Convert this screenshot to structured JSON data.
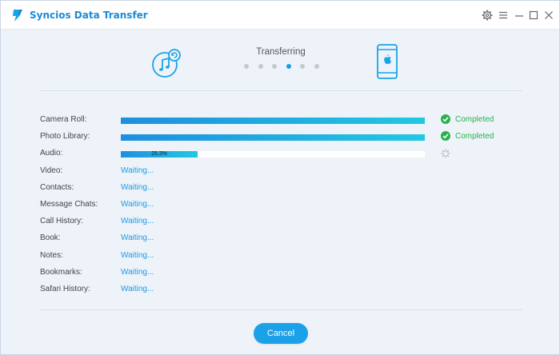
{
  "window": {
    "title": "Syncios Data Transfer",
    "accent": "#1a8bd5"
  },
  "titlebar_icons": [
    "settings-gear-icon",
    "menu-icon",
    "minimize-icon",
    "maximize-icon",
    "close-icon"
  ],
  "transfer": {
    "status_label": "Transferring",
    "step_count": 6,
    "active_step": 4,
    "source_icon": "itunes-music-icon",
    "target_icon": "iphone-apple-icon"
  },
  "items": [
    {
      "label": "Camera Roll:",
      "state": "completed",
      "progress": 1.0,
      "status_text": "Completed"
    },
    {
      "label": "Photo Library:",
      "state": "completed",
      "progress": 1.0,
      "status_text": "Completed"
    },
    {
      "label": "Audio:",
      "state": "in_progress",
      "progress": 0.253,
      "progress_text": "25.3%"
    },
    {
      "label": "Video:",
      "state": "waiting",
      "waiting_text": "Waiting..."
    },
    {
      "label": "Contacts:",
      "state": "waiting",
      "waiting_text": "Waiting..."
    },
    {
      "label": "Message Chats:",
      "state": "waiting",
      "waiting_text": "Waiting..."
    },
    {
      "label": "Call History:",
      "state": "waiting",
      "waiting_text": "Waiting..."
    },
    {
      "label": "Book:",
      "state": "waiting",
      "waiting_text": "Waiting..."
    },
    {
      "label": "Notes:",
      "state": "waiting",
      "waiting_text": "Waiting..."
    },
    {
      "label": "Bookmarks:",
      "state": "waiting",
      "waiting_text": "Waiting..."
    },
    {
      "label": "Safari History:",
      "state": "waiting",
      "waiting_text": "Waiting..."
    }
  ],
  "colors": {
    "completed": "#28b14c",
    "waiting": "#1a9be6",
    "bar_start": "#1e8fde",
    "bar_end": "#22c8e3"
  },
  "footer": {
    "cancel_label": "Cancel"
  }
}
